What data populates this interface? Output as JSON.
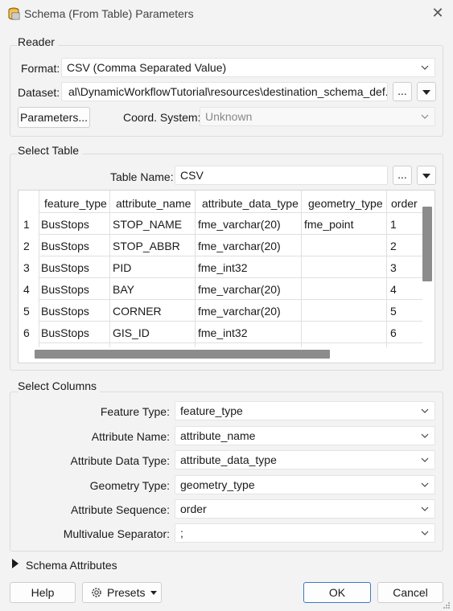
{
  "window": {
    "title": "Schema (From Table) Parameters",
    "close_glyph": "✕"
  },
  "reader": {
    "group_title": "Reader",
    "format_label": "Format:",
    "format_value": "CSV (Comma Separated Value)",
    "dataset_label": "Dataset:",
    "dataset_value": "al\\DynamicWorkflowTutorial\\resources\\destination_schema_def.csv\"",
    "browse_label": "...",
    "parameters_button": "Parameters...",
    "coord_label": "Coord. System:",
    "coord_value": "Unknown"
  },
  "select_table": {
    "group_title": "Select Table",
    "table_name_label": "Table Name:",
    "table_name_value": "CSV",
    "browse_label": "...",
    "columns": [
      "feature_type",
      "attribute_name",
      "attribute_data_type",
      "geometry_type",
      "order"
    ],
    "rows": [
      {
        "num": "1",
        "cells": [
          "BusStops",
          "STOP_NAME",
          "fme_varchar(20)",
          "fme_point",
          "1"
        ]
      },
      {
        "num": "2",
        "cells": [
          "BusStops",
          "STOP_ABBR",
          "fme_varchar(20)",
          "",
          "2"
        ]
      },
      {
        "num": "3",
        "cells": [
          "BusStops",
          "PID",
          "fme_int32",
          "",
          "3"
        ]
      },
      {
        "num": "4",
        "cells": [
          "BusStops",
          "BAY",
          "fme_varchar(20)",
          "",
          "4"
        ]
      },
      {
        "num": "5",
        "cells": [
          "BusStops",
          "CORNER",
          "fme_varchar(20)",
          "",
          "5"
        ]
      },
      {
        "num": "6",
        "cells": [
          "BusStops",
          "GIS_ID",
          "fme_int32",
          "",
          "6"
        ]
      }
    ]
  },
  "select_columns": {
    "group_title": "Select Columns",
    "fields": [
      {
        "label": "Feature Type:",
        "value": "feature_type"
      },
      {
        "label": "Attribute Name:",
        "value": "attribute_name"
      },
      {
        "label": "Attribute Data Type:",
        "value": "attribute_data_type"
      },
      {
        "label": "Geometry Type:",
        "value": "geometry_type"
      },
      {
        "label": "Attribute Sequence:",
        "value": "order"
      },
      {
        "label": "Multivalue Separator:",
        "value": ";"
      }
    ]
  },
  "schema_attributes": {
    "label": "Schema Attributes"
  },
  "footer": {
    "help": "Help",
    "presets": "Presets",
    "ok": "OK",
    "cancel": "Cancel"
  },
  "colors": {
    "primary_border": "#3b79c6",
    "scroll_thumb": "#8c8c8c",
    "window_bg": "#f3f3f3"
  }
}
